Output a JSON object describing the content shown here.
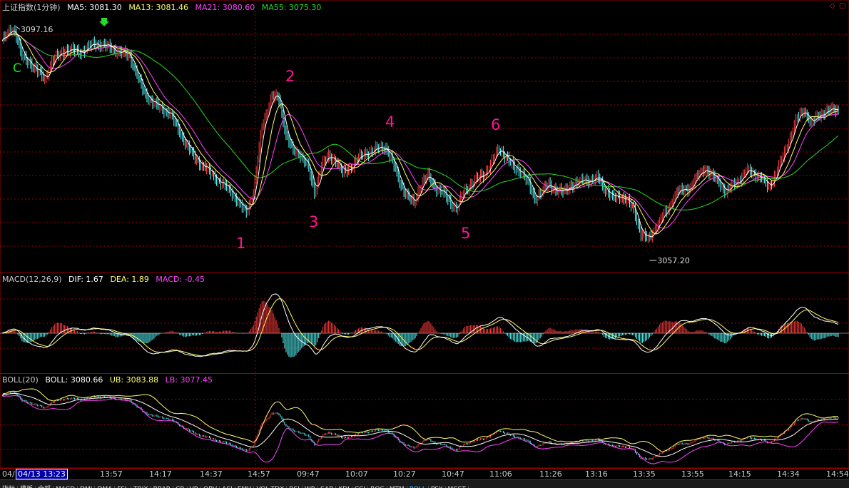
{
  "header": {
    "title": "上证指数(1分钟)",
    "ma5": "MA5: 3081.30",
    "ma13": "MA13: 3081.46",
    "ma21": "MA21: 3080.60",
    "ma55": "MA55: 3075.30"
  },
  "macd_header": {
    "title": "MACD(12,26,9)",
    "dif": "DIF: 1.67",
    "dea": "DEA: 1.89",
    "macd": "MACD: -0.45"
  },
  "boll_header": {
    "title": "BOLL(20)",
    "boll": "BOLL: 3080.66",
    "ub": "UB: 3083.88",
    "lb": "LB: 3077.45"
  },
  "corner_icons": [
    "diamond-icon",
    "square-icon"
  ],
  "colors": {
    "up": "#ff3c3c",
    "down": "#54ffff",
    "ma5": "#ffffff",
    "ma13": "#ffff66",
    "ma21": "#ff44ff",
    "ma55": "#22dd22",
    "grid": "#a00000",
    "annot": "#ff1493"
  },
  "cursor_label": "04/13 13:23",
  "time_labels": [
    "04/",
    "13:57",
    "14:17",
    "14:37",
    "14:57",
    "09:47",
    "10:07",
    "10:27",
    "10:47",
    "11:06",
    "11:26",
    "13:16",
    "13:35",
    "13:55",
    "14:15",
    "14:34",
    "14:54"
  ],
  "tabs": [
    "指标",
    "模板",
    "全部",
    "MACD",
    "DMI",
    "DMA",
    "FSL",
    "TRIX",
    "BRAR",
    "CR",
    "VR",
    "OBV",
    "ASI",
    "EMV",
    "VOL-TDX",
    "RSI",
    "WR",
    "SAR",
    "KDJ",
    "CCI",
    "ROC",
    "MTM",
    "BOLL",
    "PSY",
    "MCST"
  ],
  "active_tab": "BOLL",
  "chart_data": [
    {
      "type": "line",
      "title": "上证指数(1分钟)",
      "x_ticks": [
        "04/",
        "13:57",
        "14:17",
        "14:37",
        "14:57",
        "09:47",
        "10:07",
        "10:27",
        "10:47",
        "11:06",
        "11:26",
        "13:16",
        "13:35",
        "13:55",
        "14:15",
        "14:34",
        "14:54"
      ],
      "ylim": [
        3052.5,
        3099.5
      ],
      "annotations": [
        {
          "label": "3097.16",
          "type": "high",
          "value": 3097.16
        },
        {
          "label": "3057.20",
          "type": "low",
          "value": 3057.2
        },
        {
          "label": "C"
        },
        {
          "label": "1"
        },
        {
          "label": "2"
        },
        {
          "label": "3"
        },
        {
          "label": "4"
        },
        {
          "label": "5"
        },
        {
          "label": "6"
        }
      ],
      "close_anchors": [
        [
          0,
          3094.0
        ],
        [
          7,
          3096.2
        ],
        [
          10,
          3095.2
        ],
        [
          14,
          3091.0
        ],
        [
          20,
          3090.0
        ],
        [
          25,
          3088.5
        ],
        [
          30,
          3087.0
        ],
        [
          35,
          3090.3
        ],
        [
          45,
          3092.5
        ],
        [
          55,
          3092.0
        ],
        [
          65,
          3093.5
        ],
        [
          72,
          3093.2
        ],
        [
          80,
          3092.3
        ],
        [
          90,
          3091.3
        ],
        [
          100,
          3084.5
        ],
        [
          110,
          3082.0
        ],
        [
          118,
          3081.0
        ],
        [
          125,
          3077.5
        ],
        [
          135,
          3073.0
        ],
        [
          145,
          3070.5
        ],
        [
          155,
          3068.0
        ],
        [
          162,
          3066.5
        ],
        [
          168,
          3064.0
        ],
        [
          172,
          3063.0
        ],
        [
          177,
          3066.5
        ],
        [
          183,
          3078.5
        ],
        [
          190,
          3084.0
        ],
        [
          195,
          3083.5
        ],
        [
          200,
          3077.0
        ],
        [
          205,
          3074.0
        ],
        [
          210,
          3073.5
        ],
        [
          215,
          3071.5
        ],
        [
          220,
          3066.5
        ],
        [
          225,
          3071.5
        ],
        [
          230,
          3073.0
        ],
        [
          235,
          3072.5
        ],
        [
          240,
          3070.0
        ],
        [
          245,
          3071.0
        ],
        [
          250,
          3072.5
        ],
        [
          255,
          3073.5
        ],
        [
          260,
          3074.0
        ],
        [
          265,
          3074.5
        ],
        [
          270,
          3074.8
        ],
        [
          275,
          3072.0
        ],
        [
          280,
          3068.5
        ],
        [
          285,
          3066.0
        ],
        [
          290,
          3064.5
        ],
        [
          295,
          3068.0
        ],
        [
          300,
          3069.5
        ],
        [
          305,
          3067.5
        ],
        [
          310,
          3066.5
        ],
        [
          315,
          3065.0
        ],
        [
          320,
          3063.5
        ],
        [
          325,
          3066.5
        ],
        [
          330,
          3068.0
        ],
        [
          335,
          3069.0
        ],
        [
          340,
          3070.0
        ],
        [
          345,
          3072.0
        ],
        [
          350,
          3074.5
        ],
        [
          355,
          3073.0
        ],
        [
          360,
          3071.0
        ],
        [
          365,
          3070.5
        ],
        [
          370,
          3068.5
        ],
        [
          375,
          3065.5
        ],
        [
          380,
          3066.5
        ],
        [
          385,
          3068.0
        ],
        [
          390,
          3067.0
        ],
        [
          395,
          3066.5
        ],
        [
          400,
          3067.8
        ],
        [
          405,
          3068.0
        ],
        [
          410,
          3069.0
        ],
        [
          415,
          3068.5
        ],
        [
          420,
          3069.3
        ],
        [
          425,
          3067.0
        ],
        [
          430,
          3065.5
        ],
        [
          435,
          3066.0
        ],
        [
          440,
          3065.0
        ],
        [
          445,
          3063.5
        ],
        [
          450,
          3059.0
        ],
        [
          455,
          3058.0
        ],
        [
          460,
          3060.0
        ],
        [
          465,
          3062.0
        ],
        [
          470,
          3064.0
        ],
        [
          475,
          3066.5
        ],
        [
          480,
          3067.0
        ],
        [
          485,
          3067.5
        ],
        [
          490,
          3069.5
        ],
        [
          495,
          3071.0
        ],
        [
          500,
          3069.5
        ],
        [
          505,
          3068.5
        ],
        [
          510,
          3066.5
        ],
        [
          515,
          3068.0
        ],
        [
          520,
          3069.0
        ],
        [
          525,
          3070.5
        ],
        [
          530,
          3070.0
        ],
        [
          535,
          3069.0
        ],
        [
          540,
          3067.5
        ],
        [
          545,
          3070.0
        ],
        [
          550,
          3073.0
        ],
        [
          555,
          3076.5
        ],
        [
          560,
          3080.0
        ],
        [
          565,
          3081.5
        ],
        [
          570,
          3079.0
        ],
        [
          575,
          3080.5
        ],
        [
          580,
          3081.3
        ],
        [
          585,
          3081.5
        ]
      ],
      "series": [
        {
          "name": "MA5",
          "value": 3081.3
        },
        {
          "name": "MA13",
          "value": 3081.46
        },
        {
          "name": "MA21",
          "value": 3080.6
        },
        {
          "name": "MA55",
          "value": 3075.3
        }
      ]
    },
    {
      "type": "bar",
      "title": "MACD(12,26,9)",
      "series": [
        {
          "name": "DIF",
          "value": 1.67
        },
        {
          "name": "DEA",
          "value": 1.89
        },
        {
          "name": "MACD",
          "value": -0.45
        }
      ]
    },
    {
      "type": "line",
      "title": "BOLL(20)",
      "series": [
        {
          "name": "BOLL",
          "value": 3080.66
        },
        {
          "name": "UB",
          "value": 3083.88
        },
        {
          "name": "LB",
          "value": 3077.45
        }
      ]
    }
  ]
}
